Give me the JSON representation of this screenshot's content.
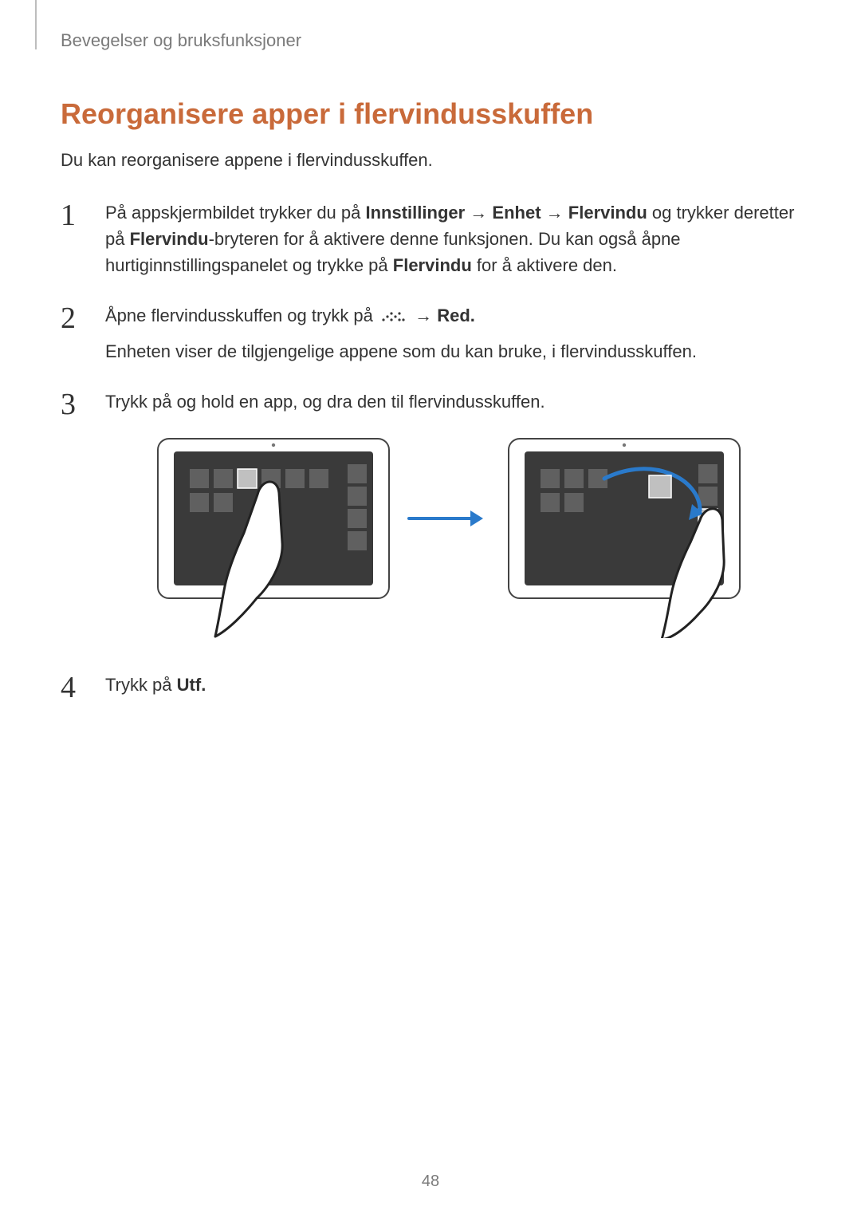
{
  "chapter": "Bevegelser og bruksfunksjoner",
  "section_title": "Reorganisere apper i flervindusskuffen",
  "intro": "Du kan reorganisere appene i flervindusskuffen.",
  "steps": {
    "s1": {
      "t1": "På appskjermbildet trykker du på ",
      "b1": "Innstillinger",
      "arrow1": " → ",
      "b2": "Enhet",
      "arrow2": " → ",
      "b3": "Flervindu",
      "t2": " og trykker deretter på ",
      "b4": "Flervindu",
      "t3": "-bryteren for å aktivere denne funksjonen. Du kan også åpne hurtiginnstillingspanelet og trykke på ",
      "b5": "Flervindu",
      "t4": " for å aktivere den."
    },
    "s2": {
      "t1": "Åpne flervindusskuffen og trykk på ",
      "arrow": " → ",
      "b1": "Red.",
      "sub": "Enheten viser de tilgjengelige appene som du kan bruke, i flervindusskuffen."
    },
    "s3": {
      "t1": "Trykk på og hold en app, og dra den til flervindusskuffen."
    },
    "s4": {
      "t1": "Trykk på ",
      "b1": "Utf."
    }
  },
  "page_number": "48"
}
